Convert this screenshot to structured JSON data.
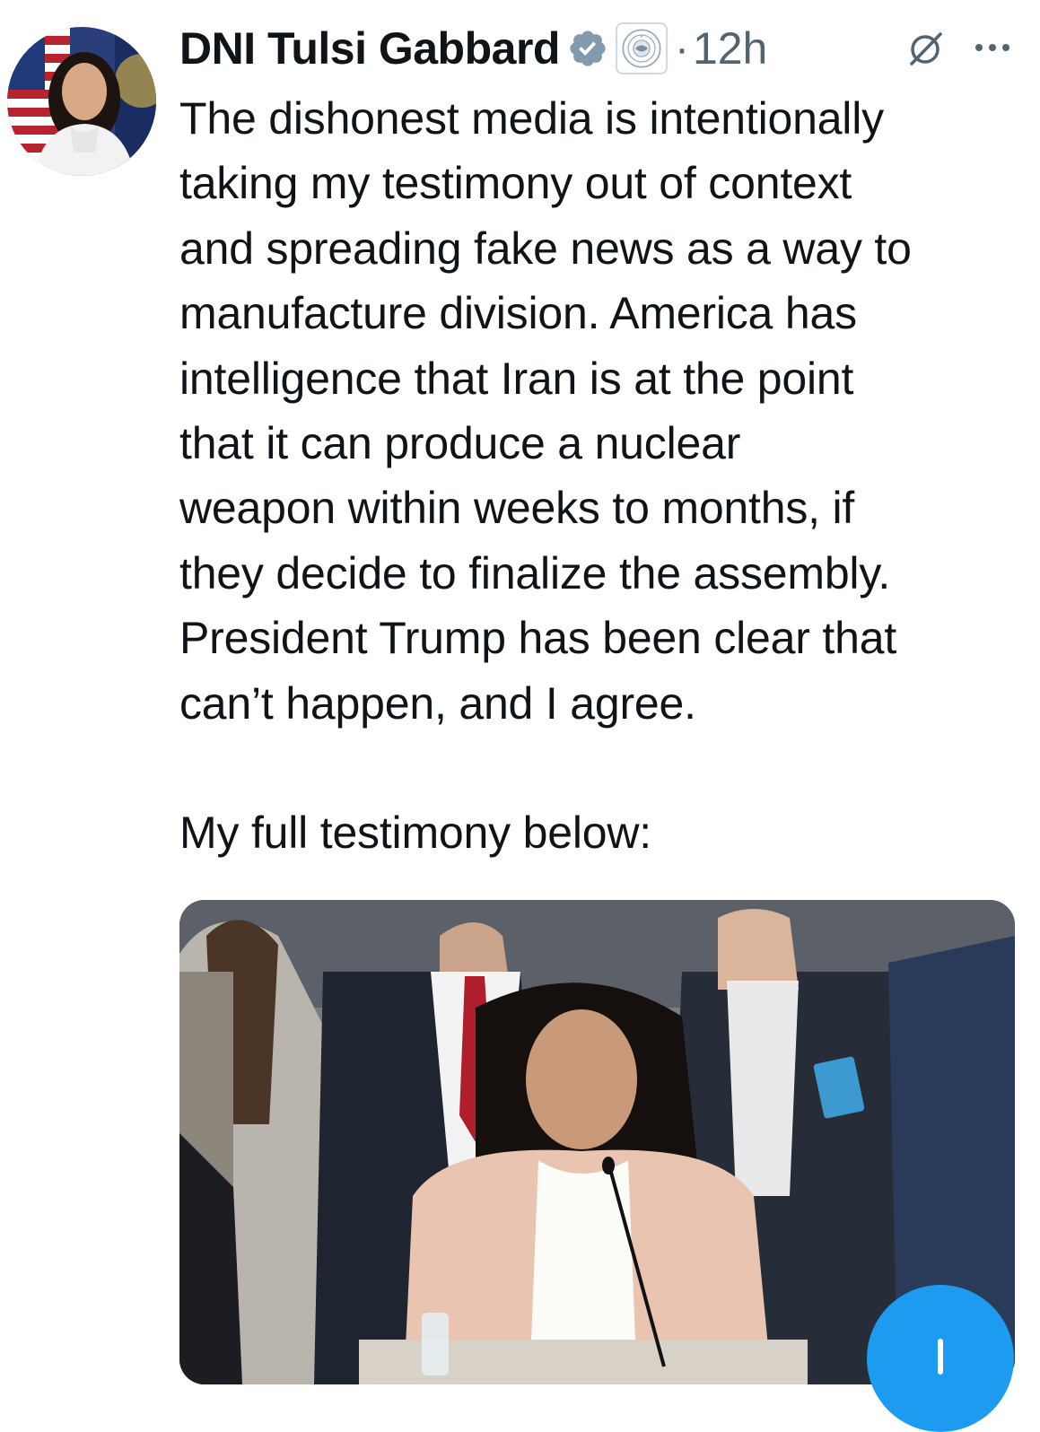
{
  "tweet": {
    "author": {
      "display_name": "DNI Tulsi Gabbard",
      "verified": true
    },
    "separator": "·",
    "timestamp": "12h",
    "text_lines": [
      "The dishonest media is intentionally",
      "taking my testimony out of context",
      "and spreading fake news as a way to",
      "manufacture division. America has",
      "intelligence that Iran is at the point",
      "that it can produce a nuclear",
      "weapon within weeks to months, if",
      "they decide to finalize the assembly.",
      "President Trump has been clear that",
      "can’t happen, and I agree.",
      "",
      "My full testimony below:"
    ]
  },
  "icons": {
    "verified": "verified-check-icon",
    "affiliation": "seal-badge-icon",
    "grok": "grok-icon",
    "more": "more-horizontal-icon",
    "fab": "compose-plus-icon"
  },
  "colors": {
    "accent": "#1d9bf0",
    "text_primary": "#0f1419",
    "text_secondary": "#536471"
  }
}
